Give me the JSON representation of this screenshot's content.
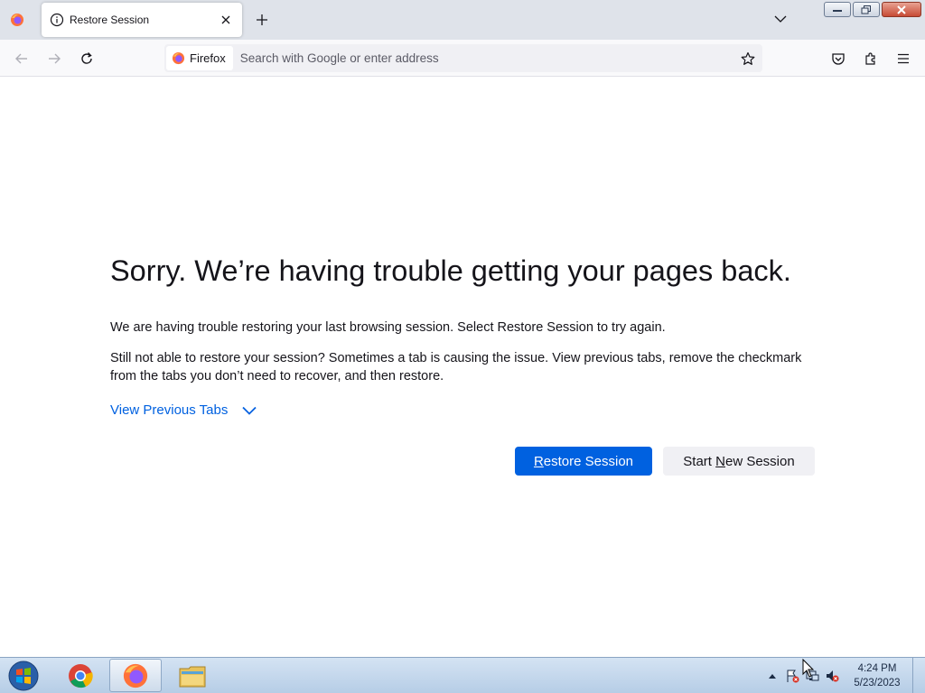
{
  "tabbar": {
    "tab_title": "Restore Session"
  },
  "navbar": {
    "identity_label": "Firefox",
    "url_placeholder": "Search with Google or enter address"
  },
  "page": {
    "title": "Sorry. We’re having trouble getting your pages back.",
    "message": "We are having trouble restoring your last browsing session. Select Restore Session to try again.",
    "details": "Still not able to restore your session? Sometimes a tab is causing the issue. View previous tabs, remove the checkmark from the tabs you don’t need to recover, and then restore.",
    "view_previous_tabs": "View Previous Tabs",
    "restore_button": {
      "accel": "R",
      "rest": "estore Session"
    },
    "new_session_button": {
      "before": "Start ",
      "accel": "N",
      "after": "ew Session"
    }
  },
  "taskbar": {
    "clock_time": "4:24 PM",
    "clock_date": "5/23/2023"
  },
  "colors": {
    "accent": "#0061e0",
    "toolbar": "#f9f9fb",
    "tabstrip": "#dfe3ea"
  }
}
